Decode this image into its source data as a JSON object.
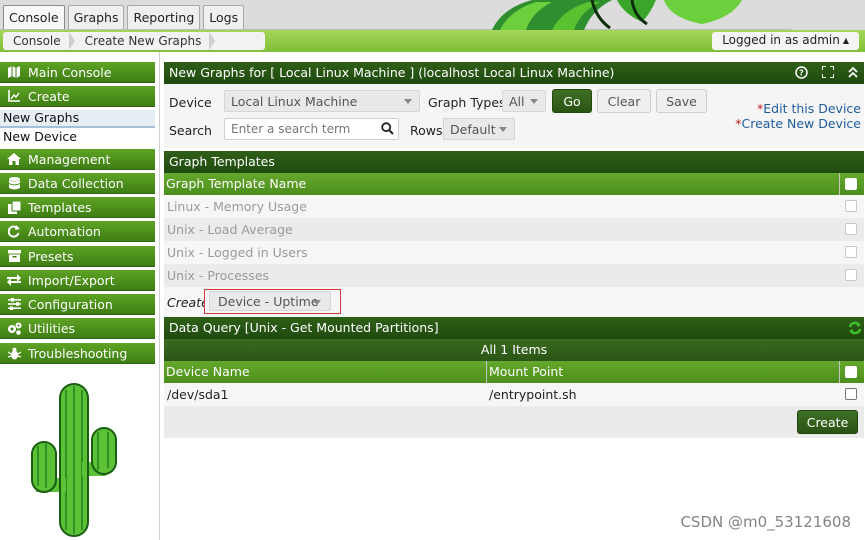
{
  "top_tabs": [
    "Console",
    "Graphs",
    "Reporting",
    "Logs"
  ],
  "breadcrumb": [
    "Console",
    "Create New Graphs"
  ],
  "logged_in": "Logged in as admin",
  "sidebar": {
    "items": [
      {
        "label": "Main Console",
        "icon": "map-icon"
      },
      {
        "label": "Create",
        "icon": "chart-icon"
      },
      {
        "label": "Management",
        "icon": "home-icon"
      },
      {
        "label": "Data Collection",
        "icon": "database-icon"
      },
      {
        "label": "Templates",
        "icon": "copy-icon"
      },
      {
        "label": "Automation",
        "icon": "refresh-icon"
      },
      {
        "label": "Presets",
        "icon": "archive-icon"
      },
      {
        "label": "Import/Export",
        "icon": "swap-icon"
      },
      {
        "label": "Configuration",
        "icon": "sliders-icon"
      },
      {
        "label": "Utilities",
        "icon": "cogs-icon"
      },
      {
        "label": "Troubleshooting",
        "icon": "bug-icon"
      }
    ],
    "subitems": [
      "New Graphs",
      "New Device"
    ]
  },
  "panel": {
    "title": "New Graphs for [ Local Linux Machine ] (localhost Local Linux Machine)",
    "device_label": "Device",
    "device_value": "Local Linux Machine",
    "graph_types_label": "Graph Types",
    "graph_types_value": "All",
    "go": "Go",
    "clear": "Clear",
    "save": "Save",
    "search_label": "Search",
    "search_placeholder": "Enter a search term",
    "rows_label": "Rows",
    "rows_value": "Default",
    "edit_link": "Edit this Device",
    "create_link": "Create New Device",
    "star": "*"
  },
  "graph_templates": {
    "title": "Graph Templates",
    "col_name": "Graph Template Name",
    "rows": [
      "Linux - Memory Usage",
      "Unix - Load Average",
      "Unix - Logged in Users",
      "Unix - Processes"
    ],
    "create_label": "Create",
    "create_select": "Device - Uptime"
  },
  "data_query": {
    "title": "Data Query [Unix - Get Mounted Partitions]",
    "items_label": "All 1 Items",
    "col_device": "Device Name",
    "col_mount": "Mount Point",
    "rows": [
      {
        "device": "/dev/sda1",
        "mount": "/entrypoint.sh"
      }
    ],
    "create_button": "Create"
  },
  "watermark": "CSDN @m0_53121608",
  "colors": {
    "accent_green": "#4b8e1c",
    "dark_green": "#2a5314",
    "highlight_red": "#d43a3a",
    "link_blue": "#1f5c9a"
  }
}
